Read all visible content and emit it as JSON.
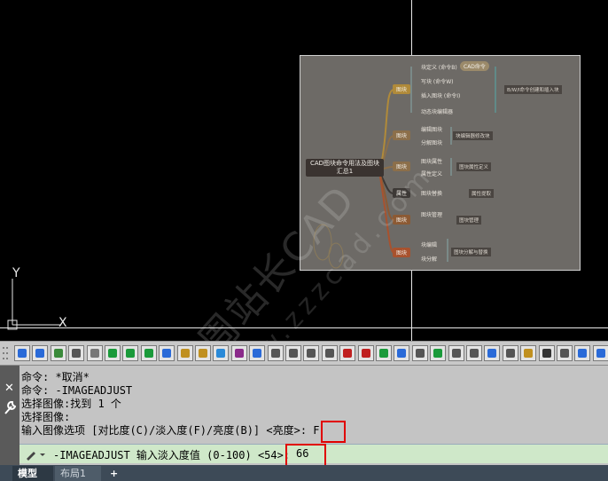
{
  "watermark": {
    "line1": "周站长CAD",
    "line2": "www.zzzcad.com"
  },
  "ucs": {
    "y_label": "Y",
    "x_label": "X"
  },
  "mindmap": {
    "center": "CAD图块命令用法及图块汇总1",
    "top_bubble": "CAD命令",
    "branches": [
      {
        "label": "图块",
        "color": "#b08a3a"
      },
      {
        "label": "图块",
        "color": "#8c6f4a"
      },
      {
        "label": "图块",
        "color": "#8c6f4a"
      },
      {
        "label": "属性",
        "color": "#3d3936"
      },
      {
        "label": "图块",
        "color": "#8c5a34"
      },
      {
        "label": "图块",
        "color": "#a8522e"
      }
    ],
    "leaves": [
      "块定义  (命令B)",
      "写块  (命令W)",
      "插入图块  (命令I)",
      "动态块编辑器",
      "编辑图块",
      "分解图块",
      "图块属性",
      "属性定义",
      "图块替换",
      "图块管理",
      "块编辑",
      "块分解"
    ],
    "notes": [
      "B/W/I命令创建和插入块",
      "块编辑器修改块",
      "图块属性定义",
      "属性提取",
      "图块管理",
      "图块分解与替换"
    ]
  },
  "command": {
    "history": [
      "命令: *取消*",
      "命令: -IMAGEADJUST",
      "选择图像:找到 1 个",
      "选择图像:",
      "输入图像选项 [对比度(C)/淡入度(F)/亮度(B)] <亮度>: F"
    ],
    "prompt": "-IMAGEADJUST 输入淡入度值 (0-100) <54>:",
    "value": "66"
  },
  "side": {
    "close": "✕",
    "wrench": "🔧"
  },
  "tabs": {
    "model": "模型",
    "layout1": "布局1",
    "add": "+"
  }
}
